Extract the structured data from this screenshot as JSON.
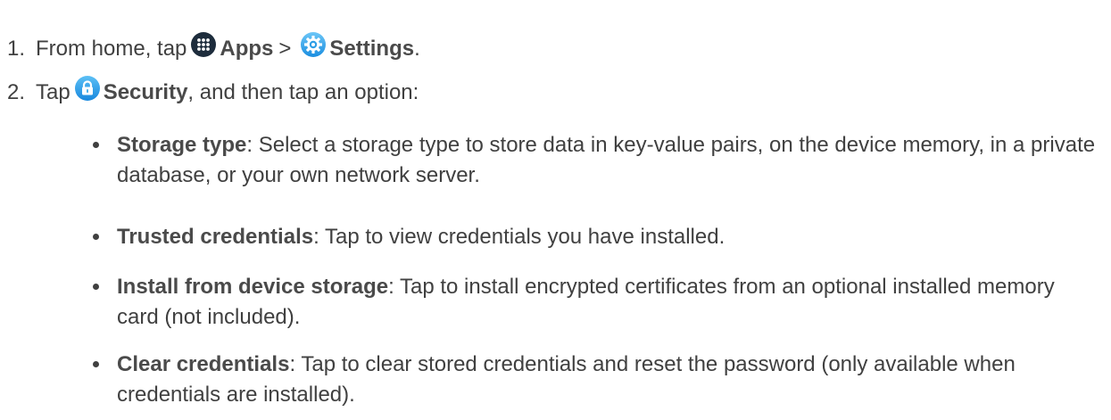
{
  "steps": [
    {
      "number": "1.",
      "prefix": "From home, tap",
      "apps_icon": "apps-grid-icon",
      "apps_label": "Apps",
      "separator": ">",
      "settings_icon": "gear-icon",
      "settings_label": "Settings",
      "suffix": "."
    },
    {
      "number": "2.",
      "prefix": "Tap",
      "security_icon": "lock-icon",
      "security_label": "Security",
      "suffix": ", and then tap an option:"
    }
  ],
  "options": [
    {
      "title": "Storage type",
      "description": ": Select a storage type to store data in key-value pairs, on the device memory, in a private database, or your own network server."
    },
    {
      "title": "Trusted credentials",
      "description": ": Tap to view credentials you have installed."
    },
    {
      "title": "Install from device storage",
      "description": ": Tap to install encrypted certificates from an optional installed memory card (not included)."
    },
    {
      "title": "Clear credentials",
      "description": ": Tap to clear stored credentials and reset the password (only available when credentials are installed)."
    }
  ],
  "colors": {
    "text": "#404040",
    "apps_icon_bg": "#1d2c3c",
    "settings_icon_bg": "#2e9ee6",
    "security_icon_bg": "#1f9ee8"
  }
}
